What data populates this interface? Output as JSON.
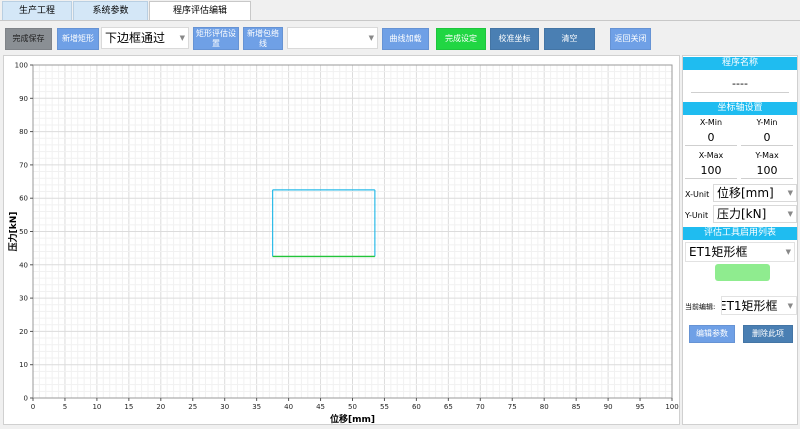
{
  "tabs": [
    {
      "label": "生产工程",
      "active": false
    },
    {
      "label": "系统参数",
      "active": false
    },
    {
      "label": "程序评估编辑",
      "active": true
    }
  ],
  "toolbar": {
    "finish_save": "完成保存",
    "new_rect": "新增矩形",
    "rect_type_value": "下边框通过",
    "rect_eval_settings": "矩形评估设置",
    "new_envelope": "新增包络线",
    "envelope_value": "",
    "load_curve": "曲线加载",
    "finish_set": "完成设定",
    "calibrate": "校准坐标",
    "clear": "清空",
    "return_close": "返回关闭"
  },
  "side": {
    "program_name_header": "程序名称",
    "program_name_value": "----",
    "axis_header": "坐标轴设置",
    "xmin_label": "X-Min",
    "ymin_label": "Y-Min",
    "xmin_value": "0",
    "ymin_value": "0",
    "xmax_label": "X-Max",
    "ymax_label": "Y-Max",
    "xmax_value": "100",
    "ymax_value": "100",
    "xunit_label": "X-Unit",
    "xunit_value": "位移[mm]",
    "yunit_label": "Y-Unit",
    "yunit_value": "压力[kN]",
    "tools_header": "评估工具启用列表",
    "tool_selected": "ET1矩形框",
    "current_edit_label": "当前编辑:",
    "current_edit_value": "ET1矩形框",
    "edit_params": "编辑参数",
    "delete_item": "删除此项"
  },
  "colors": {
    "tab_bg": "#d4e7f7",
    "button_blue": "#6fa0e6",
    "button_steel": "#4a7fb3",
    "button_green": "#21d643",
    "section_header": "#1fbcf0",
    "rect_outline": "#2bbbe8",
    "rect_bottom": "#22c43a"
  },
  "chart_data": {
    "type": "scatter",
    "xlabel": "位移[mm]",
    "ylabel": "压力[kN]",
    "xlim": [
      0,
      100
    ],
    "ylim": [
      0,
      100
    ],
    "xticks": [
      0,
      5,
      10,
      15,
      20,
      25,
      30,
      35,
      40,
      45,
      50,
      55,
      60,
      65,
      70,
      75,
      80,
      85,
      90,
      95,
      100
    ],
    "yticks": [
      0,
      10,
      20,
      30,
      40,
      50,
      60,
      70,
      80,
      90,
      100
    ],
    "grid": true,
    "rectangle": {
      "name": "ET1矩形框",
      "x_min": 37.5,
      "x_max": 53.5,
      "y_min": 42.5,
      "y_max": 62.5
    }
  }
}
